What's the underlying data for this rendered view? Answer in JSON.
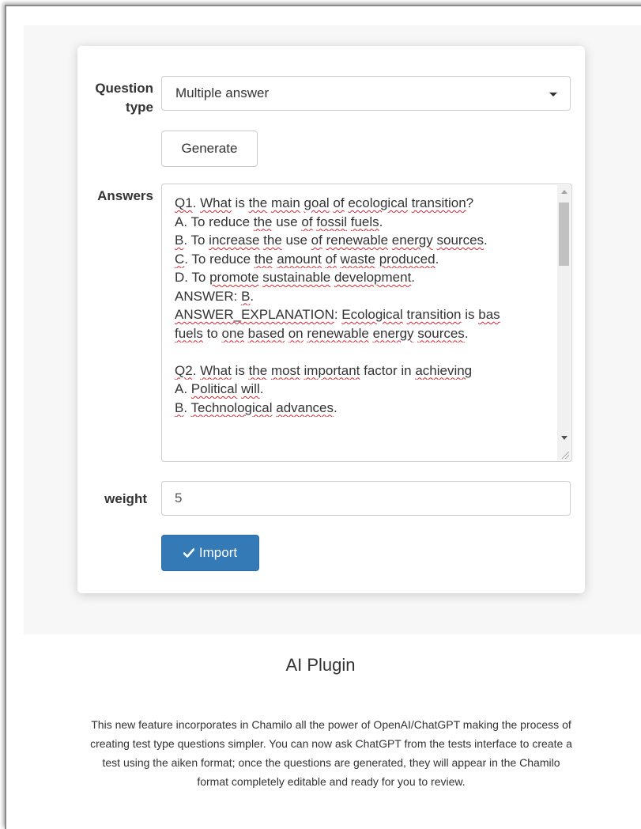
{
  "form": {
    "question_type_label_1": "Question",
    "question_type_label_2": "type",
    "question_type_value": "Multiple answer",
    "generate_label": "Generate",
    "answers_label": "Answers",
    "answers_lines": [
      "Q1. What is the main goal of ecological transition?",
      "A. To reduce the use of fossil fuels.",
      "B. To increase the use of renewable energy sources.",
      "C. To reduce the amount of waste produced.",
      "D. To promote sustainable development.",
      "ANSWER: B.",
      "ANSWER_EXPLANATION: Ecological transition is bas",
      "fuels to one based on renewable energy sources.",
      "",
      "Q2. What is the most important factor in achieving",
      "A. Political will.",
      "B. Technological advances."
    ],
    "weight_label": "weight",
    "weight_value": "5",
    "import_label": "Import"
  },
  "caption": {
    "title": "AI Plugin",
    "description_lines": [
      "This new feature incorporates in Chamilo all the power of OpenAI/ChatGPT making the process of",
      "creating test type questions simpler. You can now ask ChatGPT from the tests interface to create a",
      "test using the aiken format; once the questions are generated, they will appear in the Chamilo",
      "format completely editable and ready for you to review."
    ]
  },
  "colors": {
    "primary": "#337ab7",
    "spellcheck": "#d9232e"
  }
}
